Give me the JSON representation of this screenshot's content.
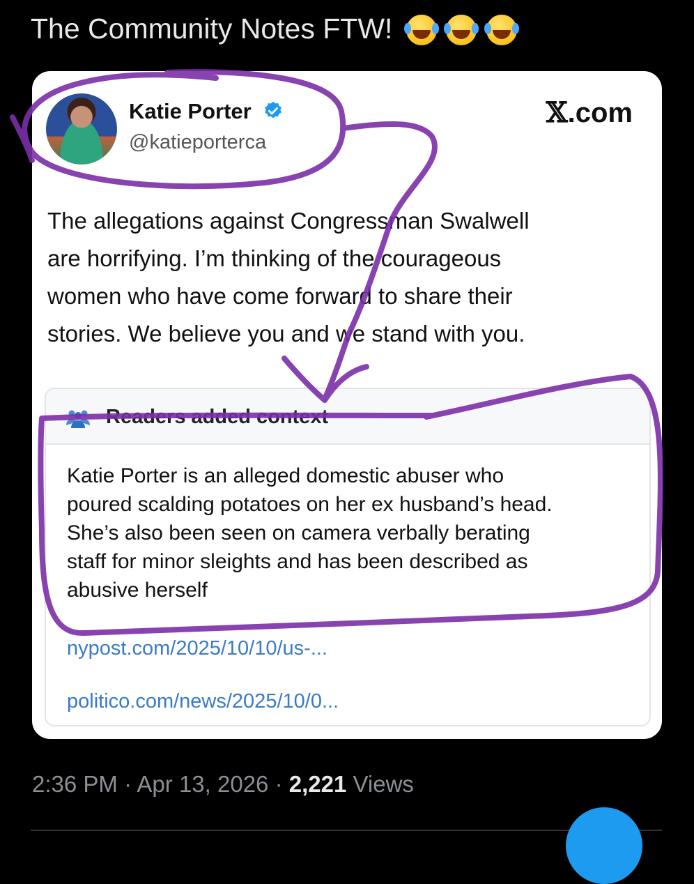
{
  "post": {
    "text": "The Community Notes FTW!",
    "emojis": [
      "face-with-tears-of-joy-icon",
      "loudly-crying-face-icon",
      "face-with-tears-of-joy-icon"
    ]
  },
  "tweet_card": {
    "author_name": "Katie Porter",
    "handle": "@katieporterca",
    "site_label": ".com",
    "site_glyph": "𝕏",
    "body_lines": [
      "The allegations against Congressman Swalwell",
      "are horrifying. I’m thinking of the courageous",
      "women who have come forward to share their",
      "stories. We believe you and we stand with you."
    ]
  },
  "community_note": {
    "title": "Readers added context",
    "body_lines": [
      "Katie Porter is an alleged domestic abuser who",
      "poured scalding potatoes on her ex husband’s head.",
      "She’s also been seen on camera verbally berating",
      "staff for minor sleights and has been described as",
      "abusive herself"
    ],
    "sources": [
      "nypost.com/2025/10/10/us-...",
      "politico.com/news/2025/10/0..."
    ]
  },
  "meta": {
    "time": "2:36 PM",
    "sep1": " · ",
    "date": "Apr 13, 2026",
    "sep2": " · ",
    "views_count": "2,221",
    "views_label": " Views"
  },
  "colors": {
    "background": "#000000",
    "card": "#ffffff",
    "link": "#3b7ac8",
    "annotation_purple": "#7b2fa8",
    "fab_blue": "#1d9bf0"
  }
}
